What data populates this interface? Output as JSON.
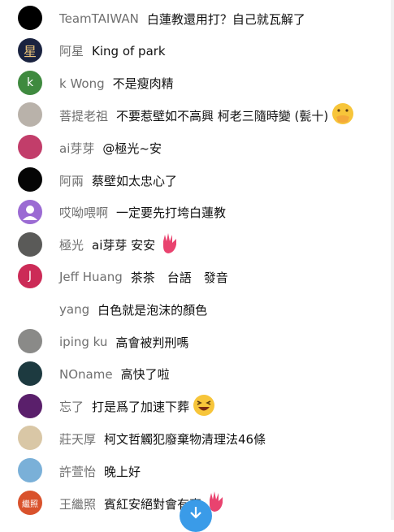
{
  "messages": [
    {
      "author": "TeamTAIWAN",
      "text": "白蓮教還用打？自己就瓦解了",
      "avatar_icon": "black-circle-avatar",
      "avatar_color": "#000000",
      "avatar_letter": ""
    },
    {
      "author": "阿星",
      "text": "King of park",
      "avatar_icon": "star-character-avatar",
      "avatar_color": "#1a2340",
      "avatar_letter": "星"
    },
    {
      "author": "k Wong",
      "text": "不是瘦肉精",
      "avatar_icon": "letter-k-avatar",
      "avatar_color": "#3f8a3f",
      "avatar_letter": "k"
    },
    {
      "author": "菩提老祖",
      "text": "不要惹壁如不高興 柯老三隨時變 (甏十)",
      "avatar_icon": "old-man-photo-avatar",
      "avatar_color": "#b9b2aa",
      "avatar_letter": "",
      "emoji": "hand-over-mouth-emoji"
    },
    {
      "author": "ai芽芽",
      "text": "@極光~安",
      "avatar_icon": "pink-photo-avatar",
      "avatar_color": "#c23d6a",
      "avatar_letter": ""
    },
    {
      "author": "阿兩",
      "text": "蔡壁如太忠心了",
      "avatar_icon": "black-circle-avatar",
      "avatar_color": "#050505",
      "avatar_letter": ""
    },
    {
      "author": "哎呦喂啊",
      "text": "一定要先打垮白蓮教",
      "avatar_icon": "default-user-avatar",
      "avatar_color": "#9b6bd3",
      "avatar_letter": ""
    },
    {
      "author": "極光",
      "text": "ai芽芽 安安",
      "avatar_icon": "dark-photo-avatar",
      "avatar_color": "#5a5a58",
      "avatar_letter": "",
      "emoji": "waving-hand-emoji"
    },
    {
      "author": "Jeff Huang",
      "text": "茶茶　台語　發音",
      "avatar_icon": "letter-j-avatar",
      "avatar_color": "#cc2b57",
      "avatar_letter": "J"
    },
    {
      "author": "yang",
      "text": "白色就是泡沫的顏色",
      "avatar_icon": "blank-avatar",
      "avatar_color": "#ffffff",
      "avatar_letter": ""
    },
    {
      "author": "iping ku",
      "text": "高會被判刑嗎",
      "avatar_icon": "girl-photo-avatar",
      "avatar_color": "#8a8a88",
      "avatar_letter": ""
    },
    {
      "author": "NOname",
      "text": "高快了啦",
      "avatar_icon": "teal-dark-avatar",
      "avatar_color": "#1d3a40",
      "avatar_letter": ""
    },
    {
      "author": "忘了",
      "text": "打是爲了加速下葬",
      "avatar_icon": "planet-avatar",
      "avatar_color": "#5a1f6b",
      "avatar_letter": "",
      "emoji": "laughing-face-emoji"
    },
    {
      "author": "莊天厚",
      "text": "柯文哲觸犯廢棄物清理法46條",
      "avatar_icon": "glasses-man-avatar",
      "avatar_color": "#d9c7a6",
      "avatar_letter": ""
    },
    {
      "author": "許萱怡",
      "text": "晚上好",
      "avatar_icon": "woman-photo-avatar",
      "avatar_color": "#7ab0d8",
      "avatar_letter": ""
    },
    {
      "author": "王繼照",
      "text": "賓紅安絕對會有事",
      "avatar_icon": "name-seal-avatar",
      "avatar_color": "#d9522c",
      "avatar_letter": "繼照",
      "emoji": "waving-hand-emoji"
    }
  ],
  "scroll_button": {
    "icon": "arrow-down-icon",
    "color": "#3a9be8"
  }
}
